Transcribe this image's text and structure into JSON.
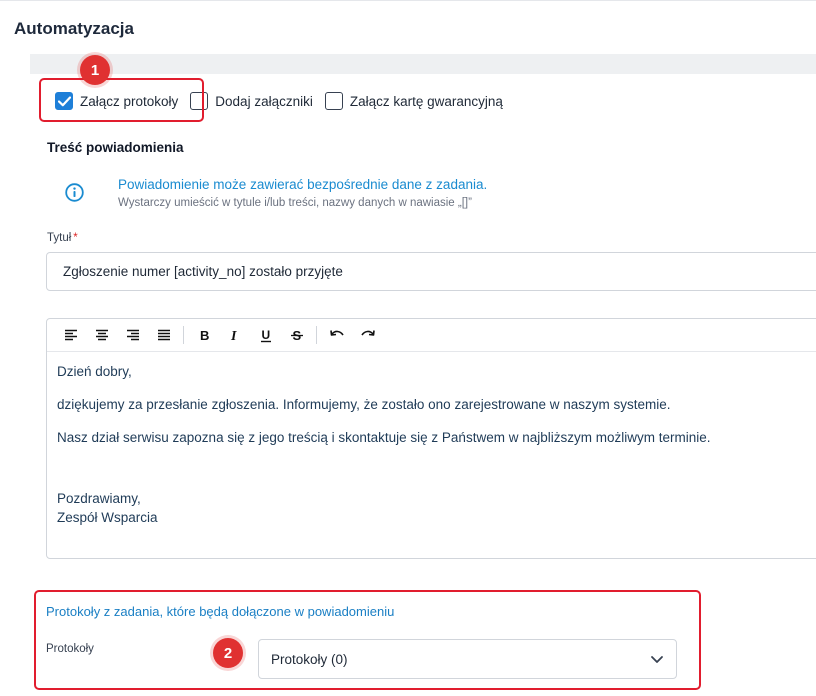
{
  "page": {
    "title": "Automatyzacja"
  },
  "attachments": {
    "options": [
      {
        "label": "Załącz protokoły",
        "checked": true
      },
      {
        "label": "Dodaj załączniki",
        "checked": false
      },
      {
        "label": "Załącz kartę gwarancyjną",
        "checked": false
      }
    ]
  },
  "markers": {
    "first": "1",
    "second": "2"
  },
  "notification": {
    "heading": "Treść powiadomienia",
    "info_title": "Powiadomienie może zawierać bezpośrednie dane z zadania.",
    "info_subtitle": "Wystarczy umieścić w tytule i/lub treści, nazwy danych w nawiasie „[]”"
  },
  "title_field": {
    "label": "Tytuł",
    "required_mark": "*",
    "value": "Zgłoszenie numer [activity_no] zostało przyjęte"
  },
  "editor": {
    "toolbar": [
      "align-left-icon",
      "align-center-icon",
      "align-right-icon",
      "align-justify-icon",
      "bold-icon",
      "italic-icon",
      "underline-icon",
      "strikethrough-icon",
      "undo-icon",
      "redo-icon"
    ],
    "paragraphs": [
      "Dzień dobry,",
      "dziękujemy za przesłanie zgłoszenia. Informujemy, że zostało ono zarejestrowane w naszym systemie.",
      "Nasz dział serwisu zapozna się z jego treścią i skontaktuje się z Państwem w najbliższym możliwym terminie."
    ],
    "signature_line1": "Pozdrawiamy,",
    "signature_line2": "Zespół Wsparcia"
  },
  "protocols": {
    "title": "Protokoły z zadania, które będą dołączone w powiadomieniu",
    "label": "Protokoły",
    "select_value": "Protokoły (0)"
  },
  "colors": {
    "accent": "#1e7fd8",
    "link": "#1a8bd0",
    "highlight": "#e11d2e",
    "marker": "#e03131"
  }
}
